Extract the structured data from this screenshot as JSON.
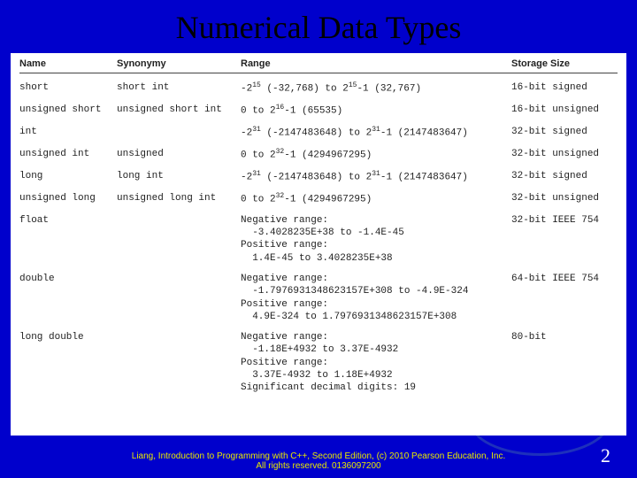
{
  "title": "Numerical Data Types",
  "headers": {
    "name": "Name",
    "synonymy": "Synonymy",
    "range": "Range",
    "storage": "Storage Size"
  },
  "rows": [
    {
      "name": "short",
      "syn": "short int",
      "range_html": "-2<sup>15</sup> (-32,768) to 2<sup>15</sup>-1 (32,767)",
      "storage": "16-bit signed"
    },
    {
      "name": "unsigned short",
      "syn": "unsigned short int",
      "range_html": "0 to 2<sup>16</sup>-1 (65535)",
      "storage": "16-bit unsigned"
    },
    {
      "name": "int",
      "syn": "",
      "range_html": "-2<sup>31</sup> (-2147483648) to 2<sup>31</sup>-1 (2147483647)",
      "storage": "32-bit signed"
    },
    {
      "name": "unsigned int",
      "syn": "unsigned",
      "range_html": "0 to 2<sup>32</sup>-1 (4294967295)",
      "storage": "32-bit unsigned"
    },
    {
      "name": "long",
      "syn": "long int",
      "range_html": "-2<sup>31</sup> (-2147483648) to 2<sup>31</sup>-1 (2147483647)",
      "storage": "32-bit signed"
    },
    {
      "name": "unsigned long",
      "syn": "unsigned long int",
      "range_html": "0 to 2<sup>32</sup>-1 (4294967295)",
      "storage": "32-bit unsigned"
    },
    {
      "name": "float",
      "syn": "",
      "range_text": "Negative range:\n  -3.4028235E+38 to -1.4E-45\nPositive range:\n  1.4E-45 to 3.4028235E+38",
      "storage": "32-bit IEEE 754"
    },
    {
      "name": "double",
      "syn": "",
      "range_text": "Negative range:\n  -1.7976931348623157E+308 to -4.9E-324\nPositive range:\n  4.9E-324 to 1.7976931348623157E+308",
      "storage": "64-bit IEEE 754"
    },
    {
      "name": "long double",
      "syn": "",
      "range_text": "Negative range:\n  -1.18E+4932 to 3.37E-4932\nPositive range:\n  3.37E-4932 to 1.18E+4932\nSignificant decimal digits: 19",
      "storage": "80-bit"
    }
  ],
  "footer": {
    "line1": "Liang, Introduction to Programming with C++, Second Edition, (c) 2010 Pearson Education, Inc.",
    "line2": "All rights reserved. 0136097200"
  },
  "page_number": "2"
}
